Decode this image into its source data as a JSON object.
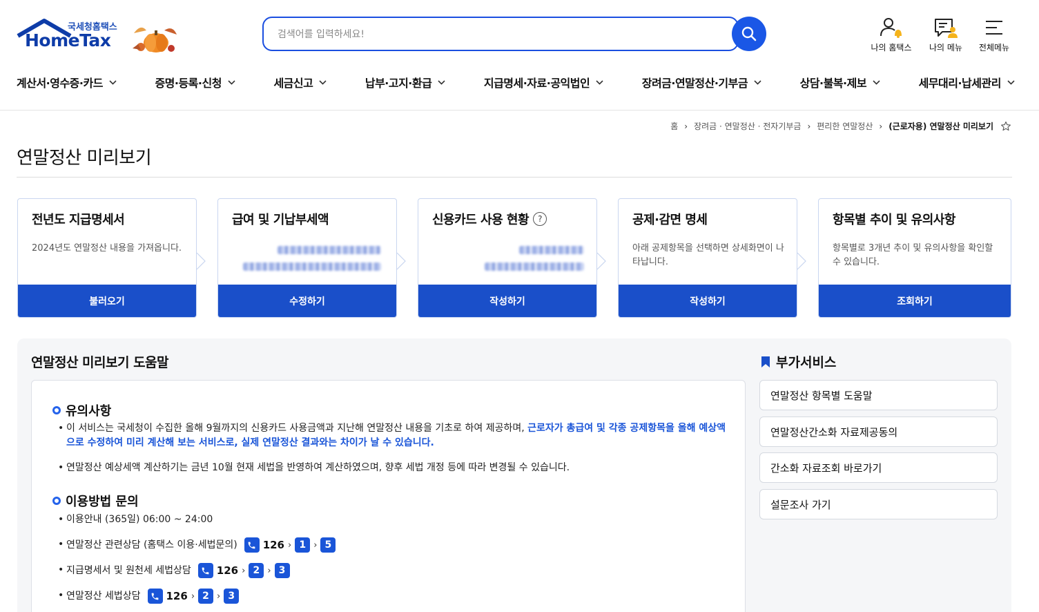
{
  "header": {
    "logo_sub": "국세청홈택스",
    "logo_main": "HomeTax",
    "search_placeholder": "검색어를 입력하세요!",
    "utils": [
      "나의 홈택스",
      "나의 메뉴",
      "전체메뉴"
    ],
    "nav": [
      "계산서·영수증·카드",
      "증명·등록·신청",
      "세금신고",
      "납부·고지·환급",
      "지급명세·자료·공익법인",
      "장려금·연말정산·기부금",
      "상담·불복·제보",
      "세무대리·납세관리"
    ]
  },
  "breadcrumb": [
    "홈",
    "장려금 · 연말정산 · 전자기부금",
    "편리한 연말정산",
    "(근로자용) 연말정산 미리보기"
  ],
  "page_title": "연말정산 미리보기",
  "cards": [
    {
      "title": "전년도 지급명세서",
      "desc": "2024년도 연말정산 내용을 가져옵니다.",
      "button": "불러오기"
    },
    {
      "title": "급여 및 기납부세액",
      "desc": "",
      "button": "수정하기"
    },
    {
      "title": "신용카드 사용 현황",
      "desc": "",
      "button": "작성하기",
      "help": "?"
    },
    {
      "title": "공제·감면 명세",
      "desc": "아래 공제항목을 선택하면 상세화면이 나타납니다.",
      "button": "작성하기"
    },
    {
      "title": "항목별 추이 및 유의사항",
      "desc": "항목별로 3개년 추이 및 유의사항을 확인할 수 있습니다.",
      "button": "조회하기"
    }
  ],
  "help": {
    "title": "연말정산 미리보기 도움말",
    "notice_title": "유의사항",
    "notice_1_plain": "이 서비스는 국세청이 수집한 올해 9월까지의 신용카드 사용금액과 지난해 연말정산 내용을 기초로 하여 제공하며, ",
    "notice_1_highlight": "근로자가 총급여 및 각종 공제항목을 올해 예상액으로 수정하여 미리 계산해 보는 서비스로, 실제 연말정산 결과와는 차이가 날 수 있습니다.",
    "notice_2": "연말정산 예상세액 계산하기는 금년 10월 현재 세법을 반영하여 계산하였으며, 향후 세법 개정 등에 따라 변경될 수 있습니다.",
    "usage_title": "이용방법 문의",
    "hours": "이용안내 (365일) 06:00 ~ 24:00",
    "contacts": [
      {
        "label": "연말정산 관련상담 (홈택스 이용·세법문의)",
        "number": "126",
        "keys": [
          "1",
          "5"
        ]
      },
      {
        "label": "지급명세서 및 원천세 세법상담",
        "number": "126",
        "keys": [
          "2",
          "3"
        ]
      },
      {
        "label": "연말정산 세법상담",
        "number": "126",
        "keys": [
          "2",
          "3"
        ]
      }
    ]
  },
  "extra": {
    "title": "부가서비스",
    "items": [
      "연말정산 항목별 도움말",
      "연말정산간소화 자료제공동의",
      "간소화 자료조회 바로가기",
      "설문조사 가기"
    ]
  },
  "colors": {
    "primary": "#1a4fc9",
    "accent": "#1a55d8",
    "search_border": "#1a4ee0"
  }
}
